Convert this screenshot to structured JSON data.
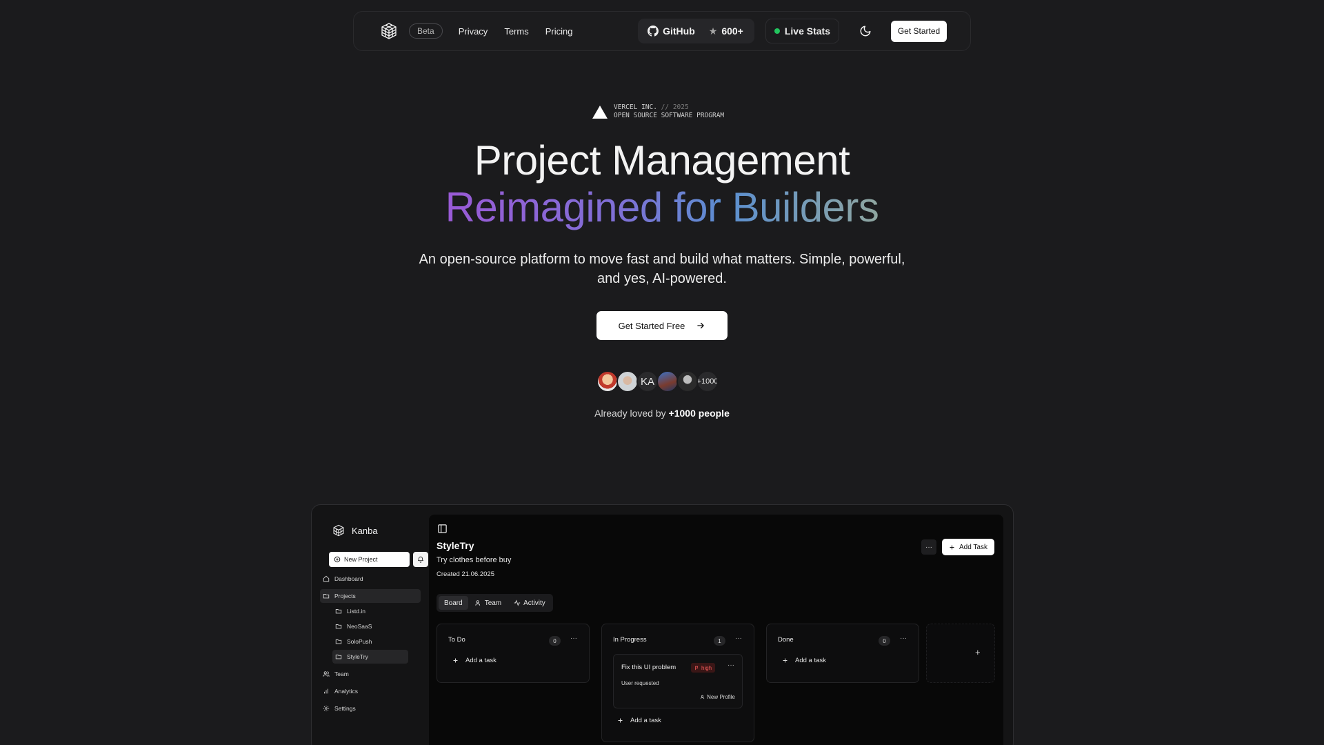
{
  "nav": {
    "beta": "Beta",
    "links": [
      "Privacy",
      "Terms",
      "Pricing"
    ],
    "github_label": "GitHub",
    "github_stars": "600+",
    "live_stats": "Live Stats",
    "get_started": "Get Started",
    "icons": {
      "logo": "cube-logo-icon",
      "github": "github-icon",
      "star": "star-icon",
      "theme": "moon-icon"
    }
  },
  "hero": {
    "badge_line1": "VERCEL INC.",
    "badge_line1_dim": "// 2025",
    "badge_line2": "OPEN SOURCE SOFTWARE PROGRAM",
    "title_line1": "Project Management",
    "title_line2": "Reimagined for Builders",
    "subtitle_line1": "An open-source platform to move fast and build what matters. Simple, powerful,",
    "subtitle_line2": "and yes, AI-powered.",
    "cta": "Get Started Free",
    "avatar_initials": "KA",
    "avatar_more": "+1000",
    "loved_prefix": "Already loved by",
    "loved_count": "+1000 people"
  },
  "app": {
    "brand": "Kanba",
    "new_project": "New Project",
    "sidebar": {
      "dashboard": "Dashboard",
      "projects": "Projects",
      "project_items": [
        "Listd.in",
        "NeoSaaS",
        "SoloPush",
        "StyleTry"
      ],
      "team": "Team",
      "analytics": "Analytics",
      "settings": "Settings"
    },
    "project": {
      "title": "StyleTry",
      "description": "Try clothes before buy",
      "created": "Created 21.06.2025",
      "more": "···",
      "add_task": "Add Task"
    },
    "tabs": [
      "Board",
      "Team",
      "Activity"
    ],
    "columns": [
      {
        "name": "To Do",
        "count": "0",
        "add": "Add a task"
      },
      {
        "name": "In Progress",
        "count": "1",
        "add": "Add a task"
      },
      {
        "name": "Done",
        "count": "0",
        "add": "Add a task"
      }
    ],
    "card": {
      "title": "Fix this UI problem",
      "priority": "high",
      "subtitle": "User requested",
      "owner": "New Profile"
    },
    "colors": {
      "accent_green": "#22c55e",
      "priority_red": "#ef5a5a"
    }
  }
}
